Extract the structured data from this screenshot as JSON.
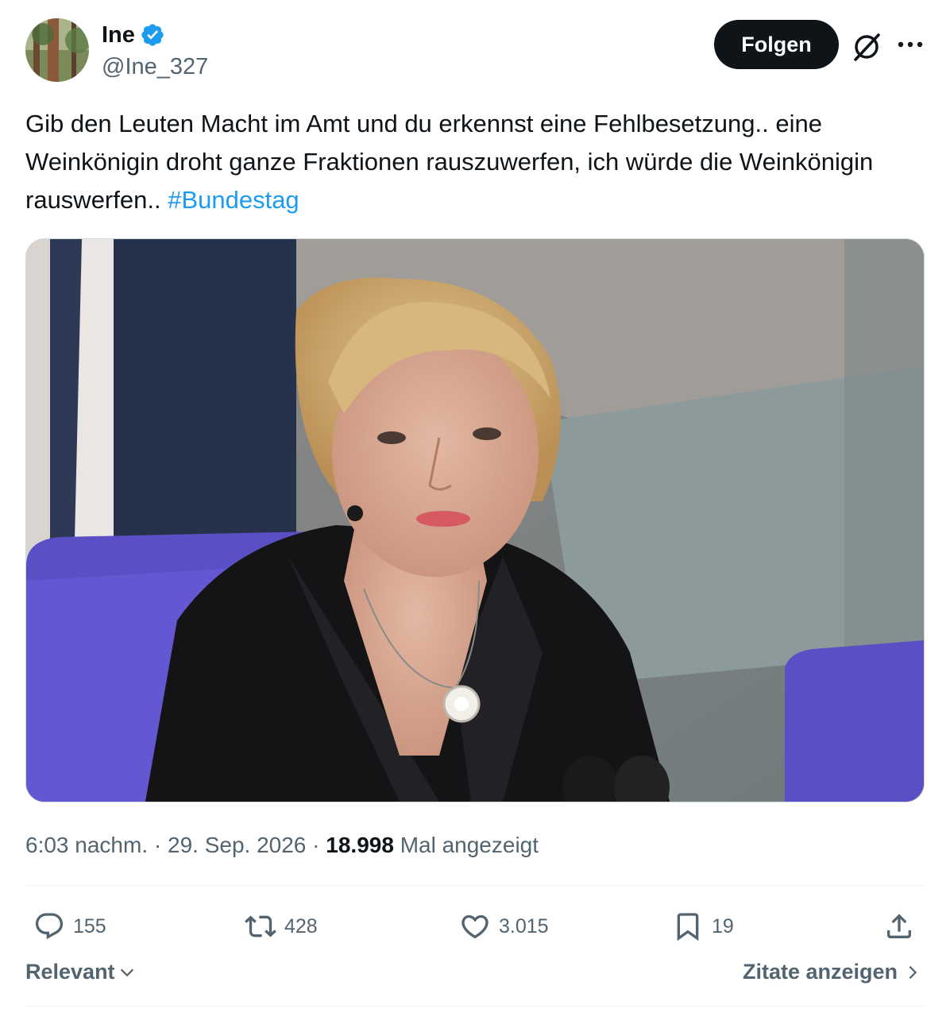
{
  "author": {
    "name": "Ine",
    "handle": "@Ine_327",
    "verified": true
  },
  "header": {
    "follow_label": "Folgen",
    "icons": [
      "grok-icon",
      "more-icon"
    ]
  },
  "tweet": {
    "text": "Gib den Leuten Macht im Amt und du erkennst eine Fehlbesetzung.. eine Weinkönigin droht ganze Fraktionen rauszuwerfen, ich würde die Weinkönigin rauswerfen.. ",
    "hashtag": "#Bundestag"
  },
  "meta": {
    "time": "6:03 nachm.",
    "separator": "·",
    "date": "29. Sep. 2026",
    "views_count": "18.998",
    "views_label": "Mal angezeigt"
  },
  "actions": {
    "replies": "155",
    "reposts": "428",
    "likes": "3.015",
    "bookmarks": "19"
  },
  "footer": {
    "sort_label": "Relevant",
    "quotes_label": "Zitate anzeigen"
  },
  "colors": {
    "text": "#0f1419",
    "secondary": "#536471",
    "accent": "#1d9bf0",
    "divider": "#eff3f4"
  }
}
